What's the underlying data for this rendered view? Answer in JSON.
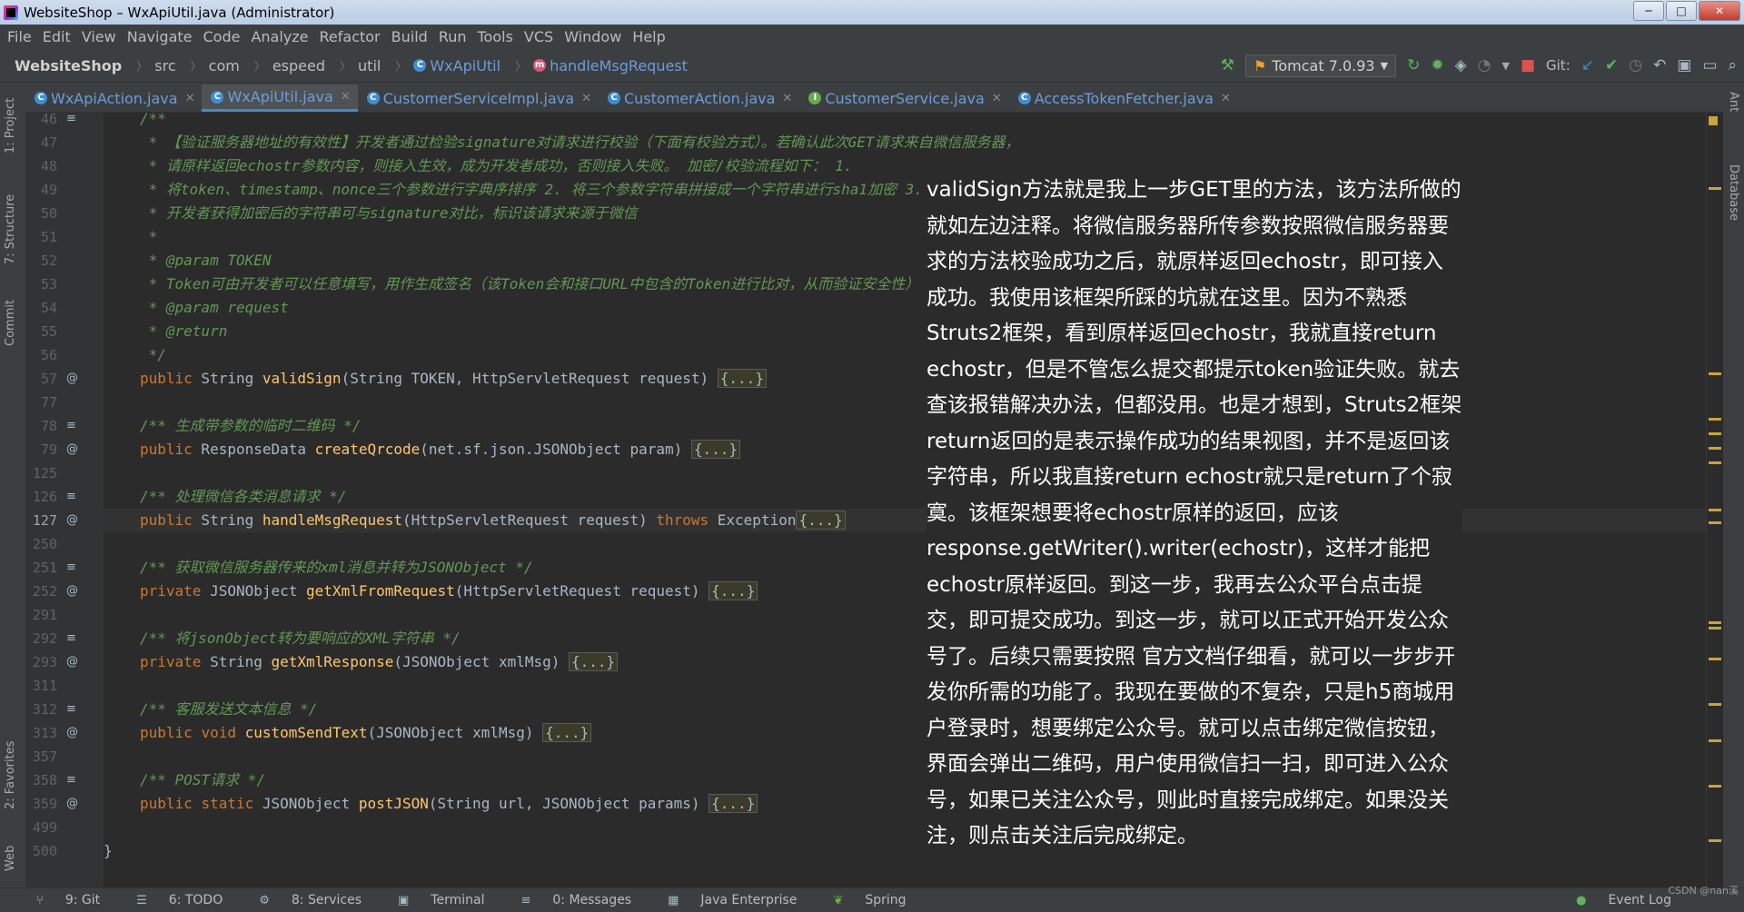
{
  "window": {
    "title": "WebsiteShop – WxApiUtil.java (Administrator)",
    "minimize": "─",
    "maximize": "□",
    "close": "✕"
  },
  "menu": [
    "File",
    "Edit",
    "View",
    "Navigate",
    "Code",
    "Analyze",
    "Refactor",
    "Build",
    "Run",
    "Tools",
    "VCS",
    "Window",
    "Help"
  ],
  "breadcrumbs": [
    "WebsiteShop",
    "src",
    "com",
    "espeed",
    "util",
    "WxApiUtil",
    "handleMsgRequest"
  ],
  "toolbar": {
    "run_config": "Tomcat 7.0.93",
    "git_label": "Git:"
  },
  "tabs": [
    {
      "label": "WxApiAction.java",
      "kind": "class"
    },
    {
      "label": "WxApiUtil.java",
      "kind": "class",
      "active": true
    },
    {
      "label": "CustomerServiceImpl.java",
      "kind": "class"
    },
    {
      "label": "CustomerAction.java",
      "kind": "class"
    },
    {
      "label": "CustomerService.java",
      "kind": "interface"
    },
    {
      "label": "AccessTokenFetcher.java",
      "kind": "class"
    }
  ],
  "left_tools": [
    "1: Project",
    "7: Structure",
    "Commit",
    "2: Favorites",
    "Web"
  ],
  "right_tools": [
    "Ant",
    "Database"
  ],
  "code_lines": [
    {
      "n": "46",
      "text": "/**",
      "cls": "cm"
    },
    {
      "n": "47",
      "text": " * 【验证服务器地址的有效性】开发者通过检验signature对请求进行校验（下面有校验方式）。若确认此次GET请求来自微信服务器，",
      "cls": "cm"
    },
    {
      "n": "48",
      "text": " * 请原样返回echostr参数内容，则接入生效，成为开发者成功，否则接入失败。 加密/校验流程如下： 1.",
      "cls": "cm"
    },
    {
      "n": "49",
      "text": " * 将token、timestamp、nonce三个参数进行字典序排序 2. 将三个参数字符串拼接成一个字符串进行sha1加密 3.",
      "cls": "cm"
    },
    {
      "n": "50",
      "text": " * 开发者获得加密后的字符串可与signature对比，标识该请求来源于微信",
      "cls": "cm"
    },
    {
      "n": "51",
      "text": " *",
      "cls": "cm"
    },
    {
      "n": "52",
      "text": " * @param TOKEN",
      "cls": "cm"
    },
    {
      "n": "53",
      "text": " * Token可由开发者可以任意填写，用作生成签名（该Token会和接口URL中包含的Token进行比对，从而验证安全性）",
      "cls": "cm"
    },
    {
      "n": "54",
      "text": " * @param request",
      "cls": "cm"
    },
    {
      "n": "55",
      "text": " * @return",
      "cls": "cm"
    },
    {
      "n": "56",
      "text": " */",
      "cls": "cm"
    },
    {
      "n": "57",
      "text": "public String validSign(String TOKEN, HttpServletRequest request) {...}"
    },
    {
      "n": "77",
      "text": ""
    },
    {
      "n": "78",
      "text": "/** 生成带参数的临时二维码 */",
      "cls": "cm"
    },
    {
      "n": "79",
      "text": "public ResponseData createQrcode(net.sf.json.JSONObject param) {...}"
    },
    {
      "n": "125",
      "text": ""
    },
    {
      "n": "126",
      "text": "/** 处理微信各类消息请求 */",
      "cls": "cm"
    },
    {
      "n": "127",
      "text": "public String handleMsgRequest(HttpServletRequest request) throws Exception{...}",
      "current": true
    },
    {
      "n": "250",
      "text": ""
    },
    {
      "n": "251",
      "text": "/** 获取微信服务器传来的xml消息并转为JSONObject */",
      "cls": "cm"
    },
    {
      "n": "252",
      "text": "private JSONObject getXmlFromRequest(HttpServletRequest request) {...}"
    },
    {
      "n": "291",
      "text": ""
    },
    {
      "n": "292",
      "text": "/** 将jsonObject转为要响应的XML字符串 */",
      "cls": "cm"
    },
    {
      "n": "293",
      "text": "private String getXmlResponse(JSONObject xmlMsg) {...}"
    },
    {
      "n": "311",
      "text": ""
    },
    {
      "n": "312",
      "text": "/** 客服发送文本信息 */",
      "cls": "cm"
    },
    {
      "n": "313",
      "text": "public void customSendText(JSONObject xmlMsg) {...}"
    },
    {
      "n": "357",
      "text": ""
    },
    {
      "n": "358",
      "text": "/** POST请求 */",
      "cls": "cm"
    },
    {
      "n": "359",
      "text": "public static JSONObject postJSON(String url, JSONObject params) {...}"
    },
    {
      "n": "499",
      "text": ""
    },
    {
      "n": "500",
      "text": "}"
    }
  ],
  "overlay_text": "validSign方法就是我上一步GET里的方法，该方法所做的就如左边注释。将微信服务器所传参数按照微信服务器要求的方法校验成功之后，就原样返回echostr，即可接入成功。我使用该框架所踩的坑就在这里。因为不熟悉Struts2框架，看到原样返回echostr，我就直接return echostr，但是不管怎么提交都提示token验证失败。就去查该报错解决办法，但都没用。也是才想到，Struts2框架return返回的是表示操作成功的结果视图，并不是返回该字符串，所以我直接return echostr就只是return了个寂寞。该框架想要将echostr原样的返回，应该response.getWriter().writer(echostr)，这样才能把echostr原样返回。到这一步，我再去公众平台点击提交，即可提交成功。到这一步，就可以正式开始开发公众号了。后续只需要按照 官方文档仔细看，就可以一步步开发你所需的功能了。我现在要做的不复杂，只是h5商城用户登录时，想要绑定公众号。就可以点击绑定微信按钮，界面会弹出二维码，用户使用微信扫一扫，即可进入公众号，如果已关注公众号，则此时直接完成绑定。如果没关注，则点击关注后完成绑定。",
  "status_bar": [
    "9: Git",
    "6: TODO",
    "8: Services",
    "Terminal",
    "0: Messages",
    "Java Enterprise",
    "Spring"
  ],
  "status_right": "Event Log",
  "watermark": "CSDN @nan溪",
  "colors": {
    "keyword": "#cc7832",
    "function": "#ffc66d",
    "comment": "#629755",
    "text": "#a9b7c6",
    "bg": "#2b2b2b"
  }
}
